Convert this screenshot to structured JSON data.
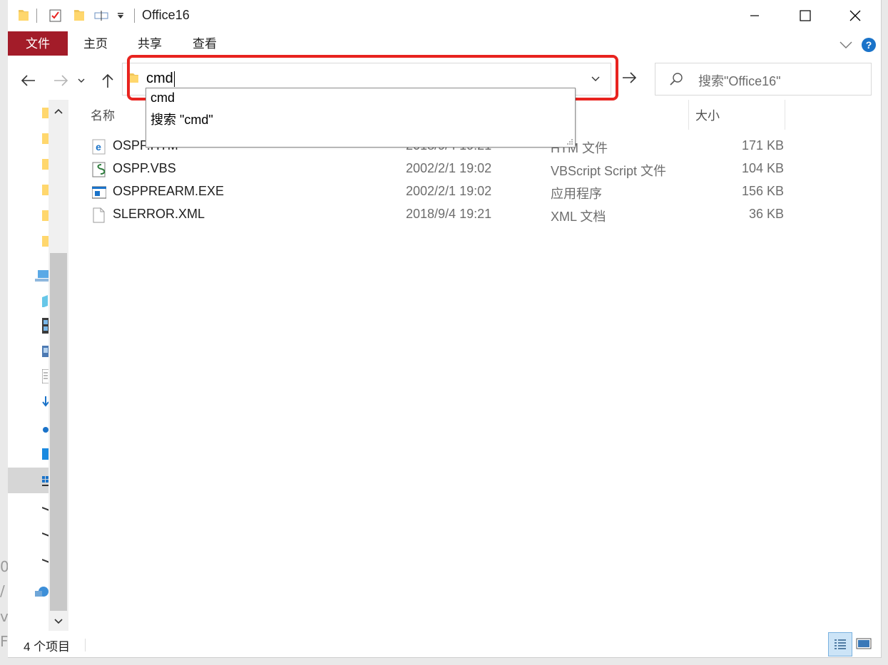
{
  "window": {
    "title": "Office16"
  },
  "ribbon": {
    "tabs": [
      "文件",
      "主页",
      "共享",
      "查看"
    ]
  },
  "address": {
    "value": "cmd"
  },
  "search": {
    "placeholder": "搜索\"Office16\""
  },
  "autocomplete": {
    "items": [
      "cmd",
      "搜索 \"cmd\""
    ]
  },
  "columns": {
    "name": "名称",
    "size": "大小"
  },
  "files": [
    {
      "name": "OSPP.HTM",
      "date": "2018/9/4 19:21",
      "type": "HTM 文件",
      "size": "171 KB",
      "icon": "html-file-icon"
    },
    {
      "name": "OSPP.VBS",
      "date": "2002/2/1 19:02",
      "type": "VBScript Script 文件",
      "size": "104 KB",
      "icon": "script-file-icon"
    },
    {
      "name": "OSPPREARM.EXE",
      "date": "2002/2/1 19:02",
      "type": "应用程序",
      "size": "156 KB",
      "icon": "exe-file-icon"
    },
    {
      "name": "SLERROR.XML",
      "date": "2018/9/4 19:21",
      "type": "XML 文档",
      "size": "36 KB",
      "icon": "xml-file-icon"
    }
  ],
  "status": {
    "item_count": "4 个项目"
  },
  "colors": {
    "file_tab": "#a31c29",
    "highlight": "#e8231f",
    "help": "#1a73c9"
  }
}
